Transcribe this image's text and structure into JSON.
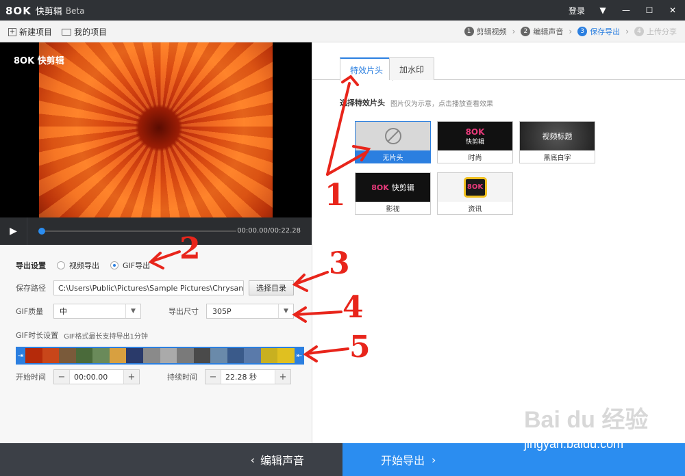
{
  "app": {
    "logo_mark": "8OK",
    "name": "快剪辑",
    "edition": "Beta"
  },
  "titlebar": {
    "login": "登录"
  },
  "toolbar": {
    "new_project": "新建项目",
    "my_projects": "我的项目"
  },
  "steps": [
    {
      "num": "1",
      "label": "剪辑视频",
      "state": "done"
    },
    {
      "num": "2",
      "label": "编辑声音",
      "state": "done"
    },
    {
      "num": "3",
      "label": "保存导出",
      "state": "active"
    },
    {
      "num": "4",
      "label": "上传分享",
      "state": "disabled"
    }
  ],
  "player": {
    "watermark": "8OK 快剪辑",
    "time": "00:00.00/00:22.28",
    "progress": 0
  },
  "export": {
    "heading": "导出设置",
    "opt_video": "视频导出",
    "opt_gif": "GIF导出",
    "selected": "GIF导出",
    "path_label": "保存路径",
    "path_value": "C:\\Users\\Public\\Pictures\\Sample Pictures\\Chrysan",
    "choose_dir": "选择目录",
    "quality_label": "GIF质量",
    "quality_value": "中",
    "size_label": "导出尺寸",
    "size_value": "305P",
    "duration_heading": "GIF时长设置",
    "duration_note": "GIF格式最长支持导出1分钟",
    "start_label": "开始时间",
    "start_value": "00:00.00",
    "length_label": "持续时间",
    "length_value": "22.28 秒"
  },
  "effects": {
    "tab_intro": "特效片头",
    "tab_watermark": "加水印",
    "section_title": "选择特效片头",
    "section_hint": "图片仅为示意，点击播放查看效果",
    "cards": [
      {
        "caption": "无片头",
        "selected": true,
        "thumb_text": ""
      },
      {
        "caption": "时尚",
        "selected": false,
        "thumb_text": "快剪辑"
      },
      {
        "caption": "黑底白字",
        "selected": false,
        "thumb_text": "视频标题"
      },
      {
        "caption": "影视",
        "selected": false,
        "thumb_text": "快剪辑"
      },
      {
        "caption": "资讯",
        "selected": false,
        "thumb_text": ""
      }
    ]
  },
  "bottom": {
    "prev": "编辑声音",
    "next": "开始导出"
  },
  "annotations": [
    "1",
    "2",
    "3",
    "4",
    "5"
  ],
  "watermark": {
    "brand": "Bai du 经验",
    "url": "jingyan.baidu.com"
  }
}
